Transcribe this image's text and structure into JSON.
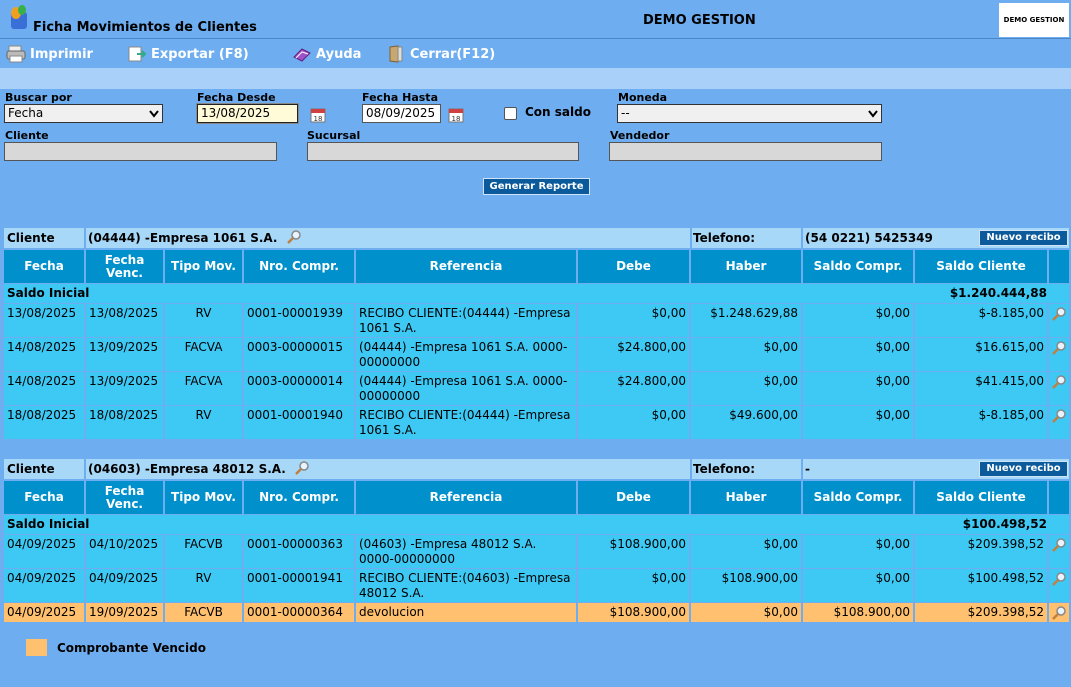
{
  "window": {
    "title": "Ficha Movimientos de Clientes",
    "company": "DEMO GESTION",
    "logo_text": "DEMO GESTION"
  },
  "toolbar": {
    "print": "Imprimir",
    "export": "Exportar (F8)",
    "help": "Ayuda",
    "close": "Cerrar(F12)"
  },
  "filters": {
    "buscar_por_label": "Buscar por",
    "buscar_por_value": "Fecha",
    "fecha_desde_label": "Fecha Desde",
    "fecha_desde_value": "13/08/2025",
    "fecha_hasta_label": "Fecha Hasta",
    "fecha_hasta_value": "08/09/2025",
    "con_saldo_label": "Con saldo",
    "moneda_label": "Moneda",
    "moneda_value": "--",
    "cliente_label": "Cliente",
    "sucursal_label": "Sucursal",
    "vendedor_label": "Vendedor",
    "generate_button": "Generar Reporte"
  },
  "columns": [
    "Fecha",
    "Fecha Venc.",
    "Tipo Mov.",
    "Nro. Compr.",
    "Referencia",
    "Debe",
    "Haber",
    "Saldo Compr.",
    "Saldo Cliente"
  ],
  "sections": [
    {
      "cliente_label": "Cliente",
      "cliente_value": "(04444) -Empresa 1061 S.A.",
      "telefono_label": "Telefono:",
      "telefono_value": "(54 0221) 5425349",
      "nuevo_recibo": "Nuevo recibo",
      "saldo_inicial_label": "Saldo Inicial",
      "saldo_inicial_value": "$1.240.444,88",
      "rows": [
        {
          "fecha": "13/08/2025",
          "venc": "13/08/2025",
          "tipo": "RV",
          "nro": "0001-00001939",
          "ref": "RECIBO CLIENTE:(04444) -Empresa 1061 S.A.",
          "debe": "$0,00",
          "haber": "$1.248.629,88",
          "saldo_compr": "$0,00",
          "saldo_cliente": "$-8.185,00"
        },
        {
          "fecha": "14/08/2025",
          "venc": "13/09/2025",
          "tipo": "FACVA",
          "nro": "0003-00000015",
          "ref": "(04444) -Empresa 1061 S.A. 0000-00000000",
          "debe": "$24.800,00",
          "haber": "$0,00",
          "saldo_compr": "$0,00",
          "saldo_cliente": "$16.615,00"
        },
        {
          "fecha": "14/08/2025",
          "venc": "13/09/2025",
          "tipo": "FACVA",
          "nro": "0003-00000014",
          "ref": "(04444) -Empresa 1061 S.A. 0000-00000000",
          "debe": "$24.800,00",
          "haber": "$0,00",
          "saldo_compr": "$0,00",
          "saldo_cliente": "$41.415,00"
        },
        {
          "fecha": "18/08/2025",
          "venc": "18/08/2025",
          "tipo": "RV",
          "nro": "0001-00001940",
          "ref": "RECIBO CLIENTE:(04444) -Empresa 1061 S.A.",
          "debe": "$0,00",
          "haber": "$49.600,00",
          "saldo_compr": "$0,00",
          "saldo_cliente": "$-8.185,00"
        }
      ]
    },
    {
      "cliente_label": "Cliente",
      "cliente_value": "(04603) -Empresa 48012 S.A.",
      "telefono_label": "Telefono:",
      "telefono_value": "-",
      "nuevo_recibo": "Nuevo recibo",
      "saldo_inicial_label": "Saldo Inicial",
      "saldo_inicial_value": "$100.498,52",
      "rows": [
        {
          "fecha": "04/09/2025",
          "venc": "04/10/2025",
          "tipo": "FACVB",
          "nro": "0001-00000363",
          "ref": "(04603) -Empresa 48012 S.A. 0000-00000000",
          "debe": "$108.900,00",
          "haber": "$0,00",
          "saldo_compr": "$0,00",
          "saldo_cliente": "$209.398,52"
        },
        {
          "fecha": "04/09/2025",
          "venc": "04/09/2025",
          "tipo": "RV",
          "nro": "0001-00001941",
          "ref": "RECIBO CLIENTE:(04603) -Empresa 48012 S.A.",
          "debe": "$0,00",
          "haber": "$108.900,00",
          "saldo_compr": "$0,00",
          "saldo_cliente": "$100.498,52"
        },
        {
          "fecha": "04/09/2025",
          "venc": "19/09/2025",
          "tipo": "FACVB",
          "nro": "0001-00000364",
          "ref": "devolucion",
          "debe": "$108.900,00",
          "haber": "$0,00",
          "saldo_compr": "$108.900,00",
          "saldo_cliente": "$209.398,52"
        }
      ]
    }
  ],
  "legend": {
    "label": "Comprobante Vencido",
    "color": "#ffc070"
  }
}
